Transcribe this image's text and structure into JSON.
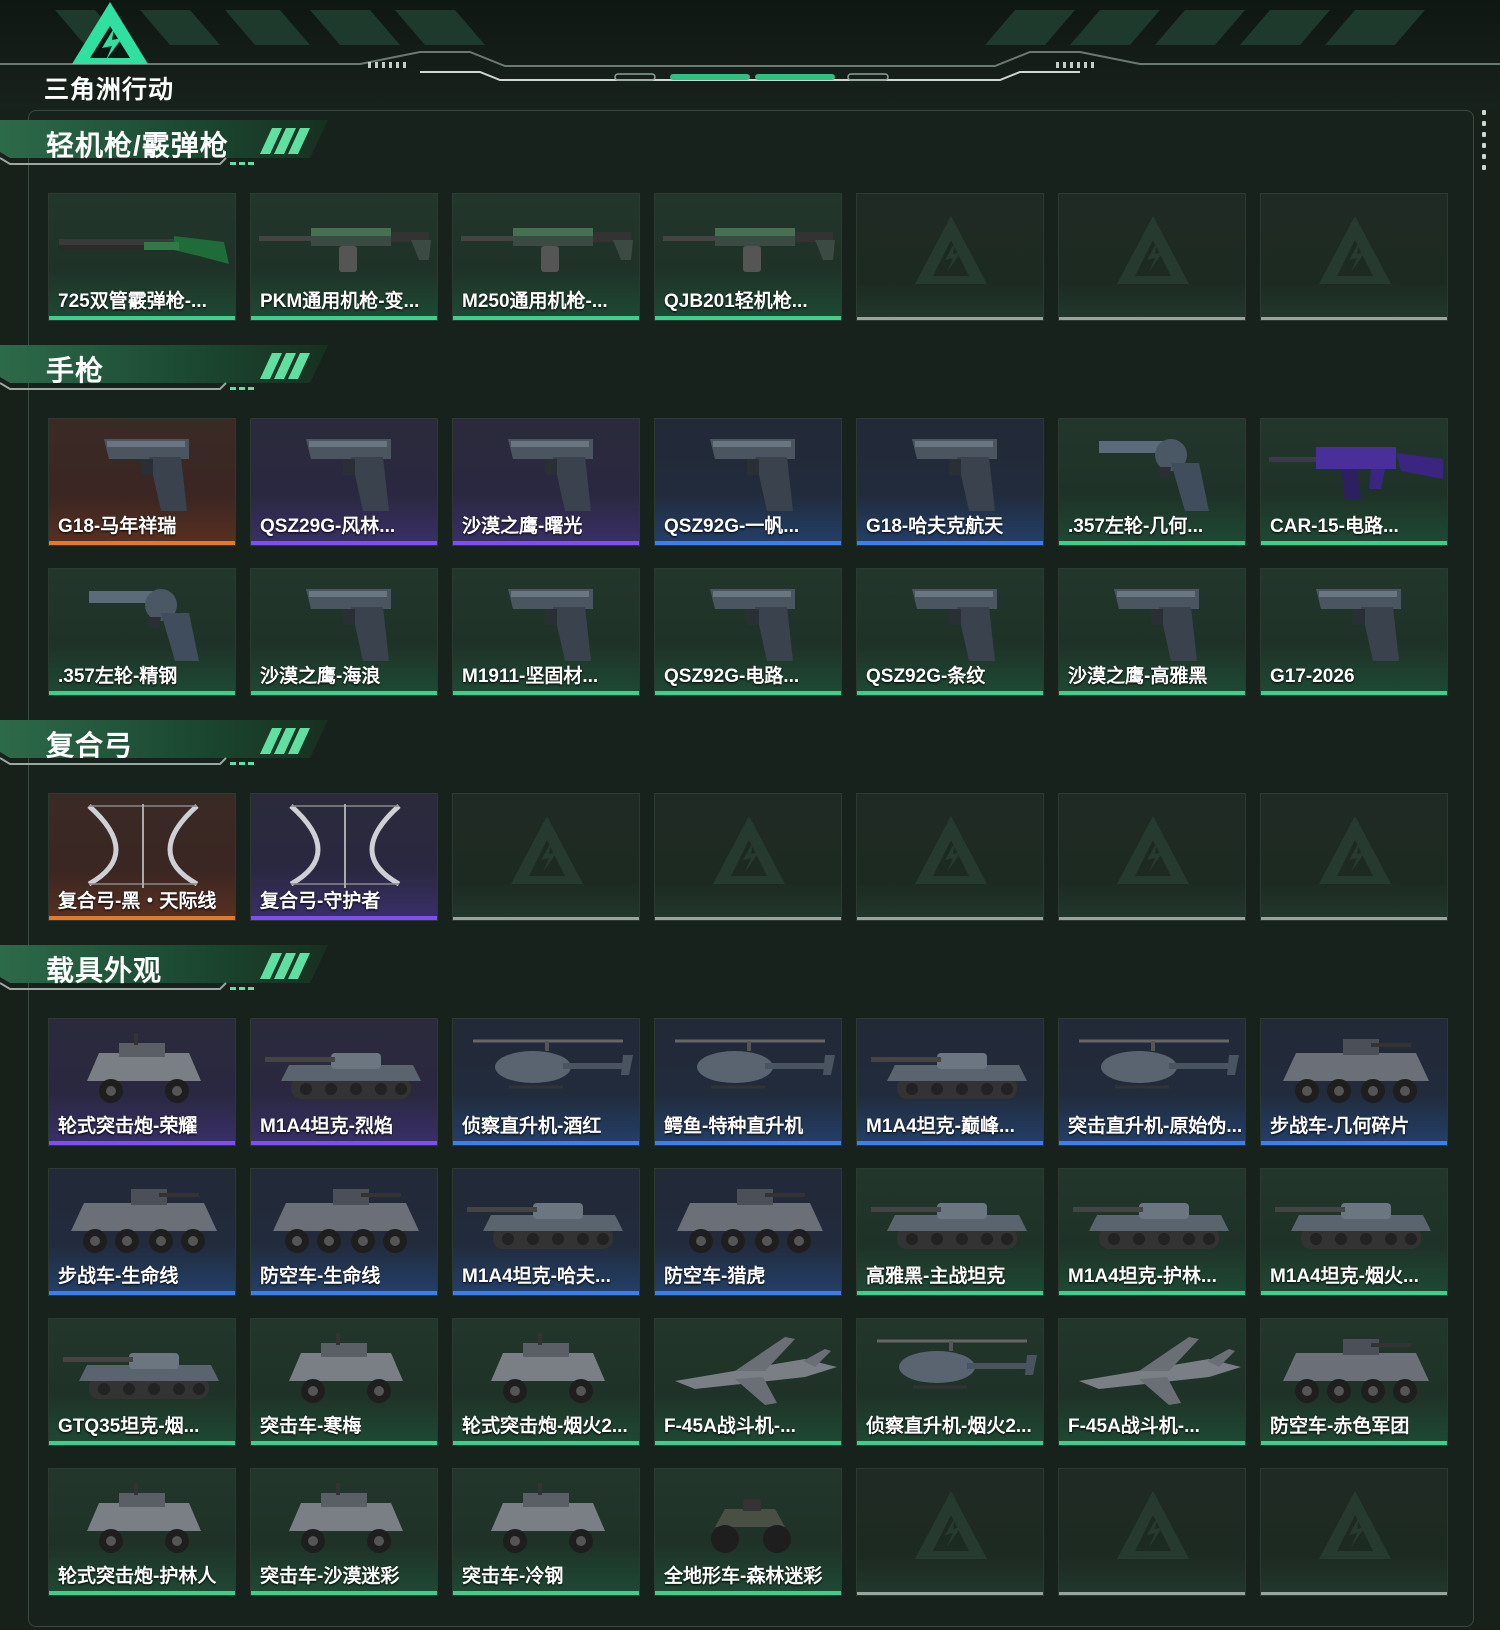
{
  "app": {
    "logo_text": "三角洲行动"
  },
  "colors": {
    "accent": "#3ed08a",
    "rarity_green": "#3ed08a",
    "rarity_purple": "#7b4ff0",
    "rarity_blue": "#3d7ee8",
    "rarity_orange": "#e07a2c",
    "empty": "#9aa39c"
  },
  "sections": [
    {
      "title": "轻机枪/霰弹枪",
      "items": [
        {
          "name": "725双管霰弹枪-...",
          "rarity": "green",
          "icon": "shotgun-icon"
        },
        {
          "name": "PKM通用机枪-变...",
          "rarity": "green",
          "icon": "machine-gun-icon"
        },
        {
          "name": "M250通用机枪-...",
          "rarity": "green",
          "icon": "machine-gun-icon"
        },
        {
          "name": "QJB201轻机枪...",
          "rarity": "green",
          "icon": "machine-gun-icon"
        },
        {
          "name": "",
          "rarity": "empty",
          "icon": "placeholder-logo-icon"
        },
        {
          "name": "",
          "rarity": "empty",
          "icon": "placeholder-logo-icon"
        },
        {
          "name": "",
          "rarity": "empty",
          "icon": "placeholder-logo-icon"
        }
      ]
    },
    {
      "title": "手枪",
      "items": [
        {
          "name": "G18-马年祥瑞",
          "rarity": "orange",
          "icon": "pistol-icon"
        },
        {
          "name": "QSZ29G-风林...",
          "rarity": "purple",
          "icon": "pistol-icon"
        },
        {
          "name": "沙漠之鹰-曙光",
          "rarity": "purple",
          "icon": "pistol-icon"
        },
        {
          "name": "QSZ92G-一帆...",
          "rarity": "blue",
          "icon": "pistol-icon"
        },
        {
          "name": "G18-哈夫克航天",
          "rarity": "blue",
          "icon": "pistol-icon"
        },
        {
          "name": ".357左轮-几何...",
          "rarity": "green",
          "icon": "revolver-icon"
        },
        {
          "name": "CAR-15-电路...",
          "rarity": "green",
          "icon": "rifle-icon"
        },
        {
          "name": ".357左轮-精钢",
          "rarity": "green",
          "icon": "revolver-icon"
        },
        {
          "name": "沙漠之鹰-海浪",
          "rarity": "green",
          "icon": "pistol-icon"
        },
        {
          "name": "M1911-坚固材...",
          "rarity": "green",
          "icon": "pistol-icon"
        },
        {
          "name": "QSZ92G-电路...",
          "rarity": "green",
          "icon": "pistol-icon"
        },
        {
          "name": "QSZ92G-条纹",
          "rarity": "green",
          "icon": "pistol-icon"
        },
        {
          "name": "沙漠之鹰-高雅黑",
          "rarity": "green",
          "icon": "pistol-icon"
        },
        {
          "name": "G17-2026",
          "rarity": "green",
          "icon": "pistol-icon"
        }
      ]
    },
    {
      "title": "复合弓",
      "items": [
        {
          "name": "复合弓-黑・天际线",
          "rarity": "orange",
          "icon": "bow-icon"
        },
        {
          "name": "复合弓-守护者",
          "rarity": "purple",
          "icon": "bow-icon"
        },
        {
          "name": "",
          "rarity": "empty",
          "icon": "placeholder-logo-icon"
        },
        {
          "name": "",
          "rarity": "empty",
          "icon": "placeholder-logo-icon"
        },
        {
          "name": "",
          "rarity": "empty",
          "icon": "placeholder-logo-icon"
        },
        {
          "name": "",
          "rarity": "empty",
          "icon": "placeholder-logo-icon"
        },
        {
          "name": "",
          "rarity": "empty",
          "icon": "placeholder-logo-icon"
        }
      ]
    },
    {
      "title": "载具外观",
      "items": [
        {
          "name": "轮式突击炮-荣耀",
          "rarity": "purple",
          "icon": "armored-car-icon"
        },
        {
          "name": "M1A4坦克-烈焰",
          "rarity": "purple",
          "icon": "tank-icon"
        },
        {
          "name": "侦察直升机-酒红",
          "rarity": "blue",
          "icon": "helicopter-icon"
        },
        {
          "name": "鳄鱼-特种直升机",
          "rarity": "blue",
          "icon": "helicopter-icon"
        },
        {
          "name": "M1A4坦克-巅峰...",
          "rarity": "blue",
          "icon": "tank-icon"
        },
        {
          "name": "突击直升机-原始伪...",
          "rarity": "blue",
          "icon": "helicopter-icon"
        },
        {
          "name": "步战车-几何碎片",
          "rarity": "blue",
          "icon": "apc-icon"
        },
        {
          "name": "步战车-生命线",
          "rarity": "blue",
          "icon": "apc-icon"
        },
        {
          "name": "防空车-生命线",
          "rarity": "blue",
          "icon": "apc-icon"
        },
        {
          "name": "M1A4坦克-哈夫...",
          "rarity": "blue",
          "icon": "tank-icon"
        },
        {
          "name": "防空车-猎虎",
          "rarity": "blue",
          "icon": "apc-icon"
        },
        {
          "name": "高雅黑-主战坦克",
          "rarity": "green",
          "icon": "tank-icon"
        },
        {
          "name": "M1A4坦克-护林...",
          "rarity": "green",
          "icon": "tank-icon"
        },
        {
          "name": "M1A4坦克-烟火...",
          "rarity": "green",
          "icon": "tank-icon"
        },
        {
          "name": "GTQ35坦克-烟...",
          "rarity": "green",
          "icon": "tank-icon"
        },
        {
          "name": "突击车-寒梅",
          "rarity": "green",
          "icon": "armored-car-icon"
        },
        {
          "name": "轮式突击炮-烟火2...",
          "rarity": "green",
          "icon": "armored-car-icon"
        },
        {
          "name": "F-45A战斗机-...",
          "rarity": "green",
          "icon": "jet-icon"
        },
        {
          "name": "侦察直升机-烟火2...",
          "rarity": "green",
          "icon": "helicopter-icon"
        },
        {
          "name": "F-45A战斗机-...",
          "rarity": "green",
          "icon": "jet-icon"
        },
        {
          "name": "防空车-赤色军团",
          "rarity": "green",
          "icon": "apc-icon"
        },
        {
          "name": "轮式突击炮-护林人",
          "rarity": "green",
          "icon": "armored-car-icon"
        },
        {
          "name": "突击车-沙漠迷彩",
          "rarity": "green",
          "icon": "armored-car-icon"
        },
        {
          "name": "突击车-冷钢",
          "rarity": "green",
          "icon": "armored-car-icon"
        },
        {
          "name": "全地形车-森林迷彩",
          "rarity": "green",
          "icon": "atv-icon"
        },
        {
          "name": "",
          "rarity": "empty",
          "icon": "placeholder-logo-icon"
        },
        {
          "name": "",
          "rarity": "empty",
          "icon": "placeholder-logo-icon"
        },
        {
          "name": "",
          "rarity": "empty",
          "icon": "placeholder-logo-icon"
        }
      ]
    }
  ]
}
